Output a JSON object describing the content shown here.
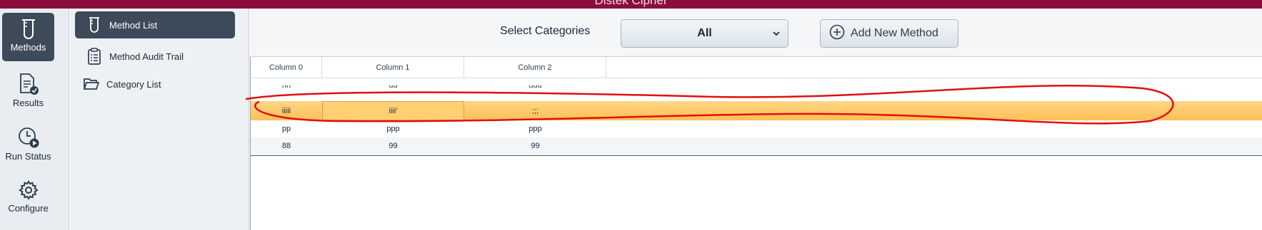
{
  "window": {
    "title": "Distek Cipher"
  },
  "rail": {
    "items": [
      {
        "label": "Methods",
        "icon": "beaker-icon",
        "active": true
      },
      {
        "label": "Results",
        "icon": "report-check-icon",
        "active": false
      },
      {
        "label": "Run Status",
        "icon": "clock-play-icon",
        "active": false
      },
      {
        "label": "Configure",
        "icon": "gear-icon",
        "active": false
      }
    ]
  },
  "sidenav": {
    "items": [
      {
        "label": "Method List",
        "icon": "beaker-icon",
        "active": true
      },
      {
        "label": "Method Audit Trail",
        "icon": "clipboard-list-icon",
        "active": false
      },
      {
        "label": "Category List",
        "icon": "folder-open-icon",
        "active": false
      }
    ]
  },
  "toolbar": {
    "category_label": "Select Categories",
    "category_value": "All",
    "add_label": "Add New Method"
  },
  "grid": {
    "columns": [
      "Column 0",
      "Column 1",
      "Column 2"
    ],
    "rows": [
      [
        "nn",
        "uu",
        "uuu"
      ],
      [
        "iiiii",
        "iiii'",
        ";;;"
      ],
      [
        "pp",
        "ppp",
        "ppp"
      ],
      [
        "88",
        "99",
        "99"
      ]
    ],
    "selected_row": 1
  },
  "colors": {
    "titlebar": "#8a0d3c",
    "active_nav": "#3d4a5a",
    "selection": "#ffc966",
    "annotation": "#e01010"
  }
}
